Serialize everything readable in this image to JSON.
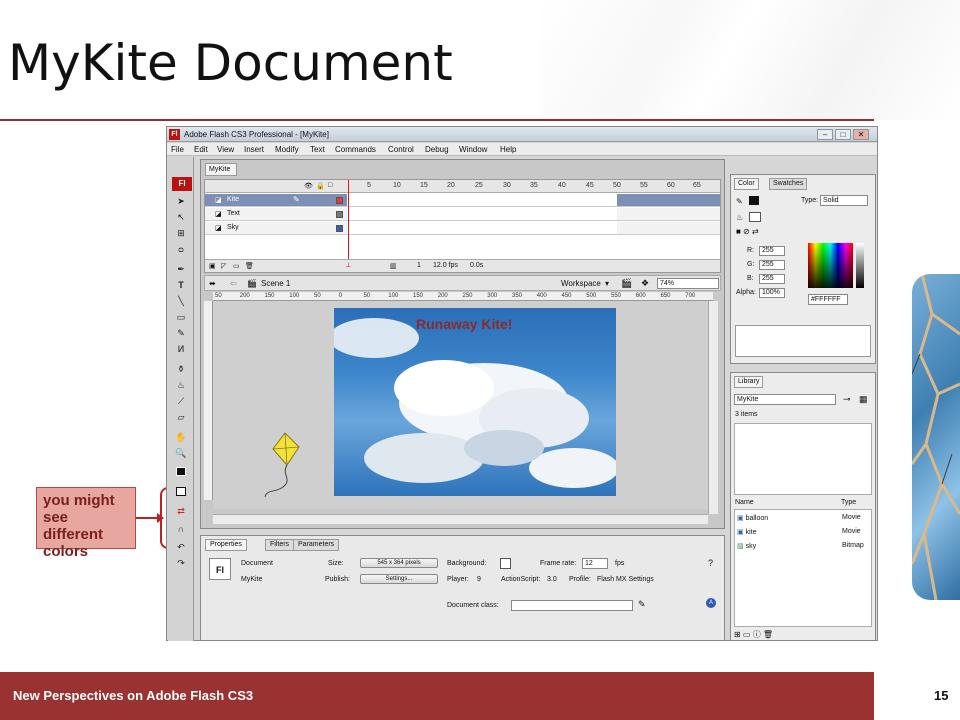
{
  "slide": {
    "title": "MyKite Document",
    "footer_text": "New Perspectives on Adobe Flash CS3",
    "page_number": "15",
    "accent_color": "#9b3232",
    "callout": "you might see different colors"
  },
  "app": {
    "title": "Adobe Flash CS3 Professional - [MyKite]",
    "icon": "Fl",
    "menu": [
      "File",
      "Edit",
      "View",
      "Insert",
      "Modify",
      "Text",
      "Commands",
      "Control",
      "Debug",
      "Window",
      "Help"
    ],
    "toolbox_logo": "Fl",
    "doc_tab": "MyKite",
    "timeline": {
      "frame_numbers": [
        "5",
        "10",
        "15",
        "20",
        "25",
        "30",
        "35",
        "40",
        "45",
        "50",
        "55",
        "60",
        "65"
      ],
      "layers": [
        {
          "name": "Kite",
          "color": "#e23a3a",
          "selected": true
        },
        {
          "name": "Text",
          "color": "#777777",
          "selected": false
        },
        {
          "name": "Sky",
          "color": "#3a5fb0",
          "selected": false
        }
      ],
      "current_frame": "1",
      "fps": "12.0 fps",
      "time": "0.0s"
    },
    "editbar": {
      "scene": "Scene 1",
      "workspace": "Workspace",
      "zoom": "74%"
    },
    "ruler_labels": [
      "50",
      "200",
      "150",
      "100",
      "50",
      "0",
      "50",
      "100",
      "150",
      "200",
      "250",
      "300",
      "350",
      "400",
      "450",
      "500",
      "550",
      "600",
      "650",
      "700"
    ],
    "stage": {
      "title": "Runaway Kite!"
    },
    "properties": {
      "tabs": [
        "Properties",
        "Filters",
        "Parameters"
      ],
      "doc_label": "Document",
      "doc_name": "MyKite",
      "size_label": "Size:",
      "size_value": "545 x 364 pixels",
      "publish_label": "Publish:",
      "settings_btn": "Settings...",
      "background_label": "Background:",
      "frame_rate_label": "Frame rate:",
      "frame_rate_value": "12",
      "fps_unit": "fps",
      "player_label": "Player:",
      "player_value": "9",
      "actionscript_label": "ActionScript:",
      "actionscript_value": "3.0",
      "profile_label": "Profile:",
      "profile_value": "Flash MX Settings",
      "doc_class_label": "Document class:",
      "icon_text": "Fl"
    },
    "color_panel": {
      "tabs": [
        "Color",
        "Swatches"
      ],
      "type_label": "Type:",
      "type_value": "Solid",
      "r_label": "R:",
      "r_value": "255",
      "g_label": "G:",
      "g_value": "255",
      "b_label": "B:",
      "b_value": "255",
      "alpha_label": "Alpha:",
      "alpha_value": "100%",
      "hex": "#FFFFFF"
    },
    "library": {
      "tab": "Library",
      "doc": "MyKite",
      "count": "3 items",
      "col_name": "Name",
      "col_type": "Type",
      "items": [
        {
          "name": "balloon",
          "type": "Movie"
        },
        {
          "name": "kite",
          "type": "Movie"
        },
        {
          "name": "sky",
          "type": "Bitmap"
        }
      ]
    }
  }
}
